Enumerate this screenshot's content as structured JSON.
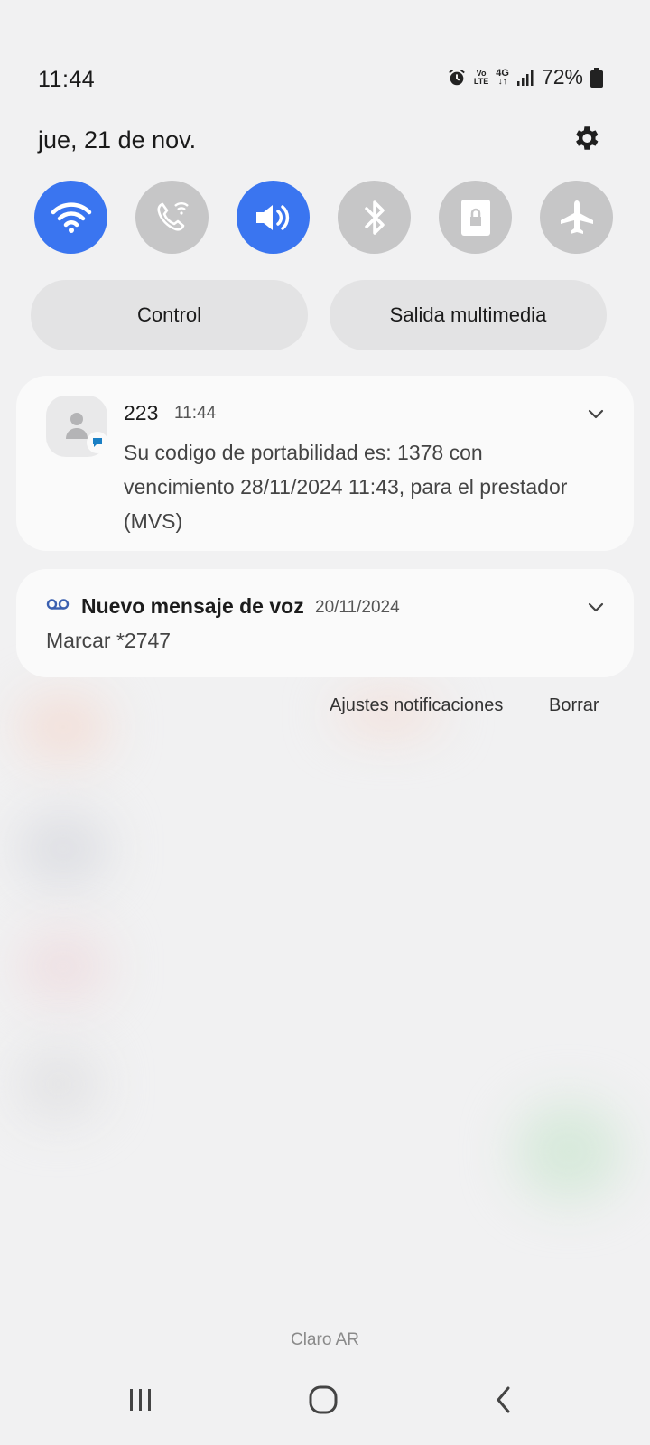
{
  "status_bar": {
    "time": "11:44",
    "volte_top": "Vo",
    "volte_bottom": "LTE",
    "network": "4G",
    "battery": "72%"
  },
  "date": "jue, 21 de nov.",
  "icons": {
    "settings": "gear-icon",
    "alarm": "alarm-icon",
    "signal": "signal-icon",
    "battery": "battery-icon"
  },
  "quick_tiles": [
    {
      "name": "wifi",
      "icon": "wifi-icon",
      "active": true
    },
    {
      "name": "wifi-calling",
      "icon": "wifi-calling-icon",
      "active": false
    },
    {
      "name": "sound",
      "icon": "volume-icon",
      "active": true
    },
    {
      "name": "bluetooth",
      "icon": "bluetooth-icon",
      "active": false
    },
    {
      "name": "rotation-lock",
      "icon": "lock-icon",
      "active": false
    },
    {
      "name": "airplane-mode",
      "icon": "airplane-icon",
      "active": false
    }
  ],
  "pills": {
    "control": "Control",
    "media_output": "Salida multimedia"
  },
  "notifications": [
    {
      "sender": "223",
      "time": "11:44",
      "body": "Su codigo de portabilidad es: 1378 con vencimiento 28/11/2024 11:43, para el prestador (MVS)"
    },
    {
      "title": "Nuevo mensaje de voz",
      "date": "20/11/2024",
      "body": "Marcar *2747"
    }
  ],
  "actions": {
    "settings": "Ajustes notificaciones",
    "clear": "Borrar"
  },
  "carrier": "Claro AR",
  "colors": {
    "accent": "#3a75f0",
    "tile_off": "#c6c6c7",
    "background": "#f1f1f2",
    "card": "#fafafa"
  }
}
